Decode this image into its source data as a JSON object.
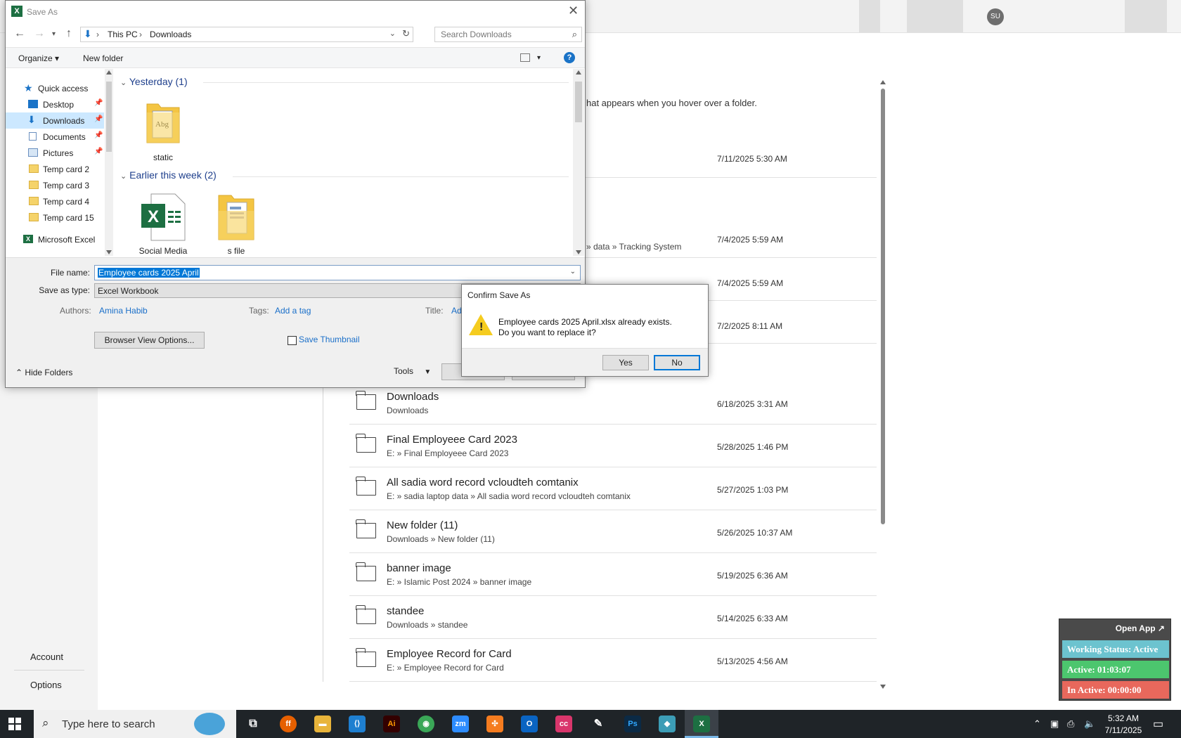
{
  "backstage": {
    "user_initials": "SU",
    "hover_hint": "hat appears when you hover over a folder.",
    "nav": {
      "account": "Account",
      "options": "Options"
    },
    "partial_rows": [
      {
        "date": "7/11/2025 5:30 AM"
      },
      {
        "path_tail": "» data » Tracking System",
        "date": "7/4/2025 5:59 AM"
      },
      {
        "date": "7/4/2025 5:59 AM"
      },
      {
        "date": "7/2/2025 8:11 AM"
      }
    ],
    "rows": [
      {
        "name": "Downloads",
        "path": "Downloads",
        "date": "6/18/2025 3:31 AM"
      },
      {
        "name": "Final  Employeee Card 2023",
        "path": "E: » Final  Employeee Card 2023",
        "date": "5/28/2025 1:46 PM"
      },
      {
        "name": "All sadia word record vcloudteh comtanix",
        "path": "E: » sadia laptop data » All sadia word record vcloudteh comtanix",
        "date": "5/27/2025 1:03 PM"
      },
      {
        "name": "New folder (11)",
        "path": "Downloads » New folder (11)",
        "date": "5/26/2025 10:37 AM"
      },
      {
        "name": "banner image",
        "path": "E: » Islamic Post 2024 » banner image",
        "date": "5/19/2025 6:36 AM"
      },
      {
        "name": "standee",
        "path": "Downloads » standee",
        "date": "5/14/2025 6:33 AM"
      },
      {
        "name": "Employee Record for Card",
        "path": "E: » Employee Record for Card",
        "date": "5/13/2025 4:56 AM"
      }
    ]
  },
  "tracker": {
    "open_app": "Open App ↗",
    "working_status": "Working Status: Active",
    "active": "Active: 01:03:07",
    "inactive": "In Active: 00:00:00",
    "colors": {
      "status": "#6cc3cf",
      "active": "#4cc66e",
      "inactive": "#e8685c"
    }
  },
  "saveas": {
    "title": "Save As",
    "address": {
      "crumb1": "This PC",
      "crumb2": "Downloads"
    },
    "search_placeholder": "Search Downloads",
    "toolbar": {
      "organize": "Organize ▾",
      "new_folder": "New folder",
      "help": "?"
    },
    "nav": [
      {
        "label": "Quick access"
      },
      {
        "label": "Desktop"
      },
      {
        "label": "Downloads"
      },
      {
        "label": "Documents"
      },
      {
        "label": "Pictures"
      },
      {
        "label": "Temp  card 2"
      },
      {
        "label": "Temp  card 3"
      },
      {
        "label": "Temp  card 4"
      },
      {
        "label": "Temp  card 15"
      },
      {
        "label": "Microsoft Excel"
      }
    ],
    "groups": [
      {
        "header": "Yesterday (1)",
        "items": [
          "static"
        ]
      },
      {
        "header": "Earlier this week (2)",
        "items": [
          "Social Media",
          "s file"
        ]
      }
    ],
    "file_name_label": "File name:",
    "file_name": "Employee cards 2025 April",
    "save_type_label": "Save as type:",
    "save_type": "Excel Workbook",
    "authors_label": "Authors:",
    "authors": "Amina Habib",
    "tags_label": "Tags:",
    "tags": "Add a tag",
    "title_label": "Title:",
    "title_value": "Ad",
    "browser_view": "Browser View Options...",
    "save_thumbnail": "Save Thumbnail",
    "hide_folders": "Hide Folders",
    "tools": "Tools"
  },
  "confirm": {
    "title": "Confirm Save As",
    "line1": "Employee cards 2025 April.xlsx already exists.",
    "line2": "Do you want to replace it?",
    "yes": "Yes",
    "no": "No"
  },
  "taskbar": {
    "search_placeholder": "Type here to search",
    "time": "5:32 AM",
    "date": "7/11/2025",
    "apps": [
      {
        "name": "task-view",
        "label": "⧉",
        "color": "#1f2428"
      },
      {
        "name": "firefox",
        "label": "ff",
        "color": "#e66000"
      },
      {
        "name": "file-explorer",
        "label": "▬",
        "color": "#e8b43a"
      },
      {
        "name": "vscode",
        "label": "⟨⟩",
        "color": "#1e7fd0"
      },
      {
        "name": "illustrator",
        "label": "Ai",
        "color": "#330000"
      },
      {
        "name": "chrome",
        "label": "◉",
        "color": "#3aa757"
      },
      {
        "name": "zoom",
        "label": "zm",
        "color": "#2d8cff"
      },
      {
        "name": "xampp",
        "label": "✣",
        "color": "#f57c1f"
      },
      {
        "name": "outlook",
        "label": "O",
        "color": "#0a64c2"
      },
      {
        "name": "creative-cloud",
        "label": "cc",
        "color": "#d9366c"
      },
      {
        "name": "pen-tool",
        "label": "✎",
        "color": "#1f2428"
      },
      {
        "name": "photoshop",
        "label": "Ps",
        "color": "#0b2a45"
      },
      {
        "name": "app-diamond",
        "label": "◆",
        "color": "#3c9db6"
      },
      {
        "name": "excel",
        "label": "X",
        "color": "#1d6f42"
      }
    ]
  }
}
